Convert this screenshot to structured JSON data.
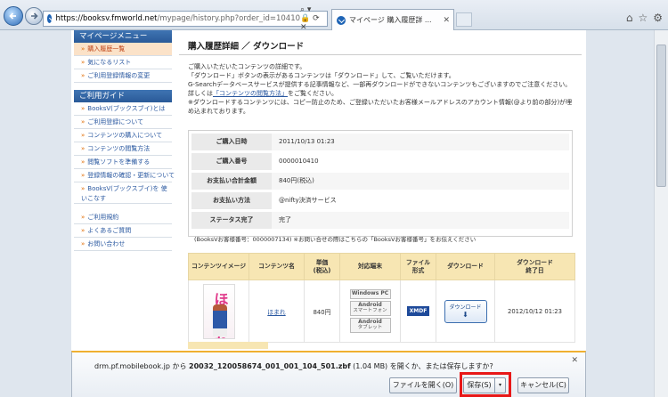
{
  "browser": {
    "url_host": "https://booksv.fmworld.net",
    "url_rest": "/mypage/history.php?order_id=10410",
    "addr_controls": "⌕ ▾ 🔒 ⟳ ✕",
    "tab_title": "マイページ 購入履歴詳 ...",
    "tab_close": "✕",
    "win_icons": [
      "⌂",
      "☆",
      "⚙"
    ]
  },
  "sidebar": {
    "mypage_head": "マイページメニュー",
    "mypage_items": [
      "購入履歴一覧",
      "気になるリスト",
      "ご利用登録情報の変更"
    ],
    "guide_head": "ご利用ガイド",
    "guide_items": [
      "BooksV(ブックスブイ)とは",
      "ご利用登録について",
      "コンテンツの購入について",
      "コンテンツの閲覧方法",
      "閲覧ソフトを準備する",
      "登録情報の確認・更新について",
      "BooksV(ブックスブイ)を 使いこなす"
    ],
    "other_items": [
      "ご利用規約",
      "よくあるご質問",
      "お問い合わせ"
    ]
  },
  "main": {
    "title": "購入履歴詳細 ／ ダウンロード",
    "intro_1": "ご購入いただいたコンテンツの詳細です。",
    "intro_2": "「ダウンロード」ボタンの表示があるコンテンツは「ダウンロード」して、ご覧いただけます。",
    "intro_3": "G-Searchデータベースサービスが提供する記事情報など、一部再ダウンロードができないコンテンツもございますのでご注意ください。",
    "intro_4a": "詳しくは",
    "intro_4link": "「コンテンツの閲覧方法」",
    "intro_4b": "をご覧ください。",
    "intro_5": "※ダウンロードするコンテンツには、コピー防止のため、ご登録いただいたお客様メールアドレスのアカウント情報(@より前の部分)が埋め込まれております。"
  },
  "order": {
    "rows": [
      {
        "label": "ご購入日時",
        "value": "2011/10/13 01:23"
      },
      {
        "label": "ご購入番号",
        "value": "0000010410"
      },
      {
        "label": "お支払い合計金額",
        "value": "840円(税込)"
      },
      {
        "label": "お支払い方法",
        "value": "@nifty決済サービス"
      },
      {
        "label": "ステータス完了",
        "value": "完了"
      }
    ],
    "note": "(BooksVお客様番号：0000007134) ※お問い合せの際はこちらの「BooksVお客様番号」をお伝えください"
  },
  "table": {
    "headers": [
      "コンテンツイメージ",
      "コンテンツ名",
      "単価\n(税込)",
      "対応端末",
      "ファイル\n形式",
      "ダウンロード",
      "ダウンロード\n終了日"
    ],
    "row": {
      "cover_text": "ほまれ",
      "title": "ほまれ",
      "price": "840円",
      "devices": [
        {
          "name": "Windows PC",
          "sub": ""
        },
        {
          "name": "Android",
          "sub": "スマートフォン"
        },
        {
          "name": "Android",
          "sub": "タブレット"
        }
      ],
      "format": "XMDF",
      "download_label": "ダウンロード",
      "download_arrow": "⬇",
      "end_date": "2012/10/12 01:23"
    }
  },
  "notification": {
    "site": "drm.pf.mobilebook.jp",
    "mid": " から ",
    "filename": "20032_120058674_001_001_104_501.zbf",
    "size_text": " (1.04 MB) を開くか、または保存しますか?",
    "open_label": "ファイルを開く(O)",
    "save_label": "保存(S)",
    "save_caret": "▾",
    "cancel_label": "キャンセル(C)",
    "close_icon": "✕"
  },
  "colors": {
    "sidebar_head": "#2a5a98",
    "active_item": "#fbe2c8",
    "table_head": "#f7e6b3",
    "highlight": "#e81818"
  }
}
